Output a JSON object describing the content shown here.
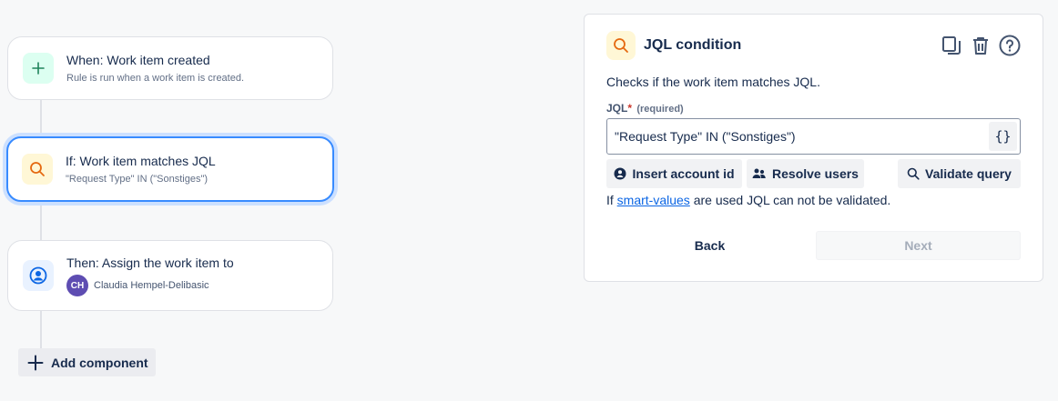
{
  "flow": {
    "trigger": {
      "title": "When: Work item created",
      "subtitle": "Rule is run when a work item is created.",
      "icon": "plus-icon"
    },
    "condition": {
      "title": "If: Work item matches JQL",
      "subtitle": "\"Request Type\" IN (\"Sonstiges\")",
      "icon": "search-icon"
    },
    "action": {
      "title": "Then: Assign the work item to",
      "avatar_initials": "CH",
      "assignee": "Claudia Hempel-Delibasic",
      "icon": "user-circle-icon"
    },
    "add_component_label": "Add component"
  },
  "panel": {
    "title": "JQL condition",
    "description": "Checks if the work item matches JQL.",
    "field_label": "JQL",
    "required_marker": "*",
    "required_text": "(required)",
    "jql_value": "\"Request Type\" IN (\"Sonstiges\")",
    "braces_label": "{}",
    "buttons": {
      "insert_account_id": "Insert account id",
      "resolve_users": "Resolve users",
      "validate_query": "Validate query"
    },
    "note_prefix": "If ",
    "note_link": "smart-values",
    "note_suffix": " are used JQL can not be validated.",
    "back_label": "Back",
    "next_label": "Next"
  },
  "colors": {
    "selected_border": "#388bff",
    "link": "#0c66e4",
    "avatar": "#5e4db2",
    "search_icon": "#e56910",
    "plus_icon": "#1f845a",
    "user_icon": "#0c66e4"
  }
}
